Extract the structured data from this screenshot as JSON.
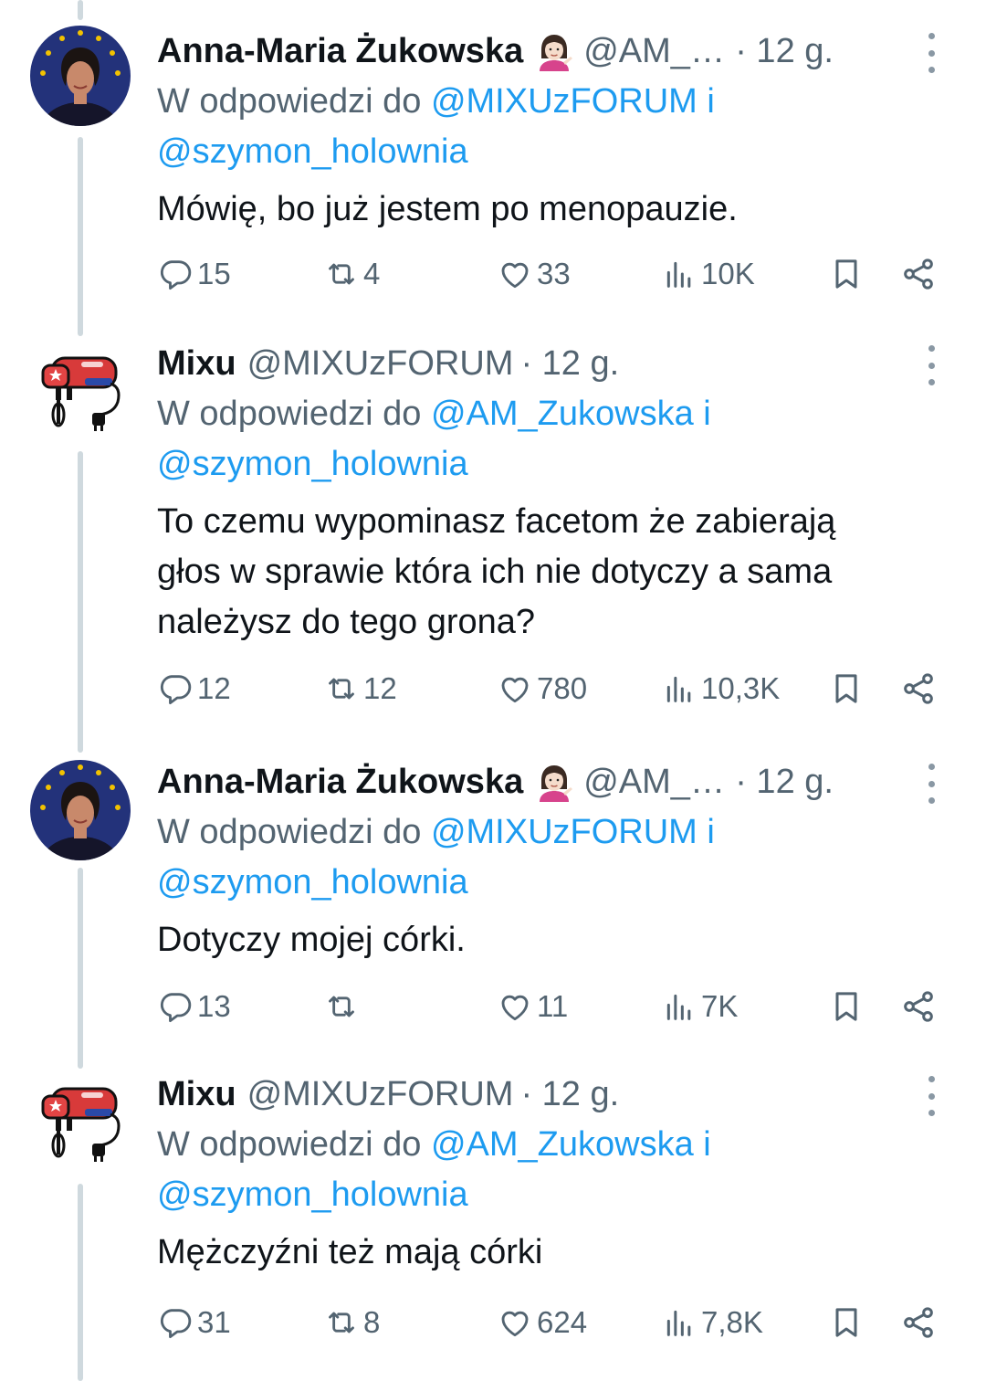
{
  "tweets": [
    {
      "author": "Anna-Maria Żukowska",
      "emoji": "person-tipping-hand-emoji",
      "handle": "@AM_Z...",
      "time": "· 12 g.",
      "reply_prefix": "W odpowiedzi do ",
      "reply_mention_1": "@MIXUzFORUM",
      "reply_joiner": " i",
      "reply_mention_2": "@szymon_holownia",
      "text": "Mówię, bo już jestem po menopauzie.",
      "stats": {
        "replies": "15",
        "retweets": "4",
        "likes": "33",
        "views": "10K"
      }
    },
    {
      "author": "Mixu",
      "handle": "@MIXUzFORUM",
      "time": "· 12 g.",
      "reply_prefix": "W odpowiedzi do ",
      "reply_mention_1": "@AM_Zukowska",
      "reply_joiner": " i",
      "reply_mention_2": "@szymon_holownia",
      "text_lines": [
        "To czemu wypominasz facetom że zabierają",
        "głos w sprawie która ich nie dotyczy a sama",
        "należysz do tego grona?"
      ],
      "stats": {
        "replies": "12",
        "retweets": "12",
        "likes": "780",
        "views": "10,3K"
      }
    },
    {
      "author": "Anna-Maria Żukowska",
      "emoji": "person-tipping-hand-emoji",
      "handle": "@AM_Z...",
      "time": "· 12 g.",
      "reply_prefix": "W odpowiedzi do ",
      "reply_mention_1": "@MIXUzFORUM",
      "reply_joiner": " i",
      "reply_mention_2": "@szymon_holownia",
      "text": "Dotyczy mojej córki.",
      "stats": {
        "replies": "13",
        "retweets": "",
        "likes": "11",
        "views": "7K"
      }
    },
    {
      "author": "Mixu",
      "handle": "@MIXUzFORUM",
      "time": "· 12 g.",
      "reply_prefix": "W odpowiedzi do ",
      "reply_mention_1": "@AM_Zukowska",
      "reply_joiner": " i",
      "reply_mention_2": "@szymon_holownia",
      "text": "Mężczyźni też mają córki",
      "stats": {
        "replies": "31",
        "retweets": "8",
        "likes": "624",
        "views": "7,8K"
      }
    }
  ],
  "colors": {
    "text": "#0f1419",
    "secondary": "#536471",
    "link": "#1d9bf0",
    "thread_line": "#cfd9de"
  }
}
